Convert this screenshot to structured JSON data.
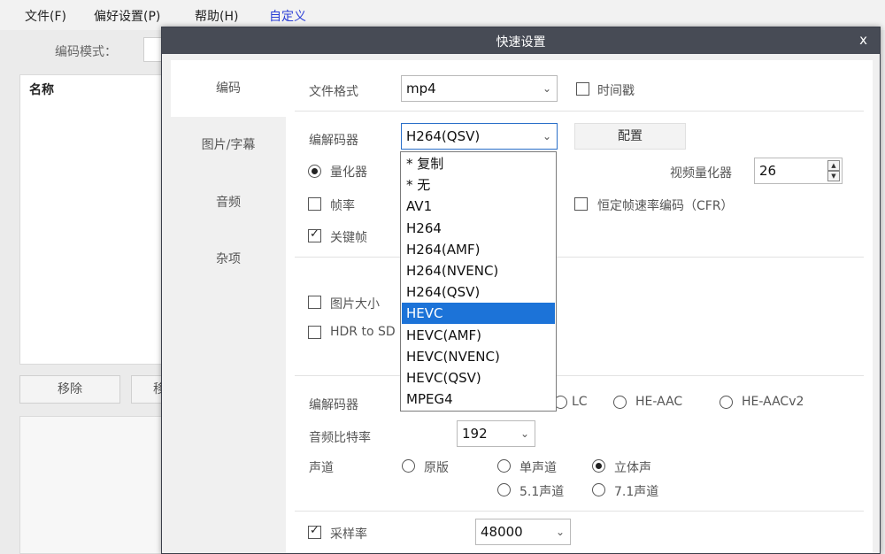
{
  "menubar": {
    "file": "文件(F)",
    "prefs": "偏好设置(P)",
    "help": "帮助(H)",
    "custom": "自定义"
  },
  "main": {
    "encode_mode_label": "编码模式：",
    "name_header": "名称",
    "remove_button": "移除",
    "other_button_partial": "移"
  },
  "dialog": {
    "title": "快速设置",
    "close": "x",
    "tabs": [
      {
        "label": "编码",
        "active": true
      },
      {
        "label": "图片/字幕",
        "active": false
      },
      {
        "label": "音频",
        "active": false
      },
      {
        "label": "杂项",
        "active": false
      }
    ],
    "file_format_label": "文件格式",
    "file_format_value": "mp4",
    "timestamp_label": "时间戳",
    "codec_label": "编解码器",
    "codec_value": "H264(QSV)",
    "config_button": "配置",
    "quantizer_label": "量化器",
    "video_quantizer_label": "视频量化器",
    "video_quantizer_value": "26",
    "framerate_label": "帧率",
    "cfr_label": "恒定帧速率编码（CFR）",
    "keyframe_label": "关键帧",
    "image_size_label": "图片大小",
    "hdr_label": "HDR to SD",
    "audio_codec_label": "编解码器",
    "audio_lc": "LC",
    "audio_he_aac": "HE-AAC",
    "audio_he_aacv2": "HE-AACv2",
    "audio_bitrate_label": "音频比特率",
    "audio_bitrate_value": "192",
    "channel_label": "声道",
    "channel_original": "原版",
    "channel_mono": "单声道",
    "channel_stereo": "立体声",
    "channel_51": "5.1声道",
    "channel_71": "7.1声道",
    "samplerate_label": "采样率",
    "samplerate_value": "48000",
    "codec_options": [
      "* 复制",
      "* 无",
      "AV1",
      "H264",
      "H264(AMF)",
      "H264(NVENC)",
      "H264(QSV)",
      "HEVC",
      "HEVC(AMF)",
      "HEVC(NVENC)",
      "HEVC(QSV)",
      "MPEG4"
    ],
    "codec_selected_index": 7
  },
  "colors": {
    "title_bar": "#474b55",
    "selection": "#1c73d8",
    "custom_menu": "#2b3fd6"
  },
  "icons": {
    "dropdown": "chevron-down-icon",
    "close": "close-icon",
    "check": "checkmark-icon"
  }
}
